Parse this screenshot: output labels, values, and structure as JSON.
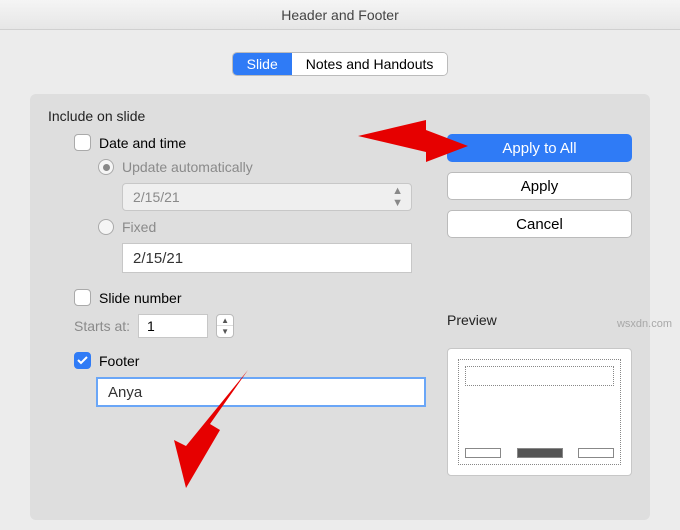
{
  "window": {
    "title": "Header and Footer"
  },
  "tabs": {
    "slide": "Slide",
    "notes": "Notes and Handouts"
  },
  "section": {
    "include": "Include on slide"
  },
  "datetime": {
    "label": "Date and time",
    "auto_label": "Update automatically",
    "auto_value": "2/15/21",
    "fixed_label": "Fixed",
    "fixed_value": "2/15/21"
  },
  "slidenum": {
    "label": "Slide number",
    "starts_label": "Starts at:",
    "starts_value": "1"
  },
  "footer": {
    "label": "Footer",
    "value": "Anya"
  },
  "buttons": {
    "apply_all": "Apply to All",
    "apply": "Apply",
    "cancel": "Cancel"
  },
  "preview": {
    "label": "Preview"
  },
  "watermark": "wsxdn.com"
}
